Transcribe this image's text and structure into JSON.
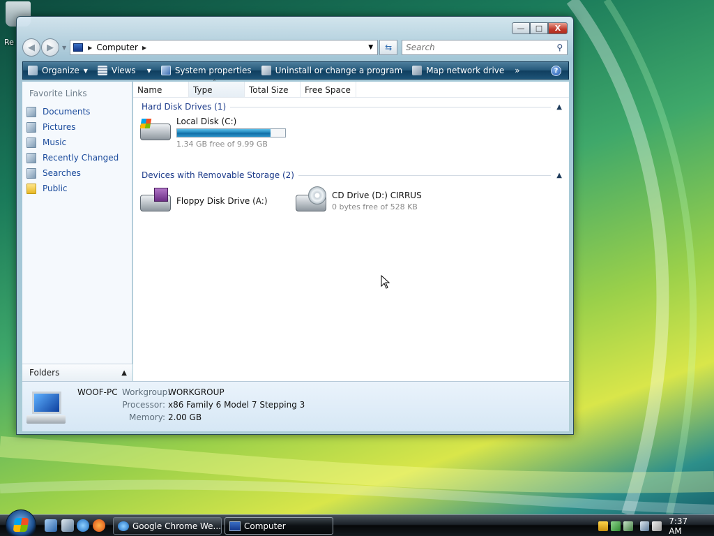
{
  "desktop": {
    "recycle_bin_label": "Re"
  },
  "window": {
    "title_buttons": {
      "minimize": "—",
      "maximize": "□",
      "close": "X"
    },
    "address": {
      "location": "Computer"
    },
    "search": {
      "placeholder": "Search"
    },
    "toolbar": {
      "organize": "Organize",
      "views": "Views",
      "system_properties": "System properties",
      "uninstall": "Uninstall or change a program",
      "map_drive": "Map network drive",
      "more": "»",
      "help": "?"
    },
    "nav_pane": {
      "heading": "Favorite Links",
      "links": [
        {
          "label": "Documents",
          "icon": "documents-icon"
        },
        {
          "label": "Pictures",
          "icon": "pictures-icon"
        },
        {
          "label": "Music",
          "icon": "music-icon"
        },
        {
          "label": "Recently Changed",
          "icon": "recent-icon"
        },
        {
          "label": "Searches",
          "icon": "searches-icon"
        },
        {
          "label": "Public",
          "icon": "folder-icon"
        }
      ],
      "folders_label": "Folders"
    },
    "columns": [
      "Name",
      "Type",
      "Total Size",
      "Free Space"
    ],
    "groups": {
      "hdd": {
        "label": "Hard Disk Drives (1)",
        "drives": [
          {
            "name": "Local Disk (C:)",
            "free_text": "1.34 GB free of 9.99 GB",
            "used_fraction": 0.866
          }
        ]
      },
      "removable": {
        "label": "Devices with Removable Storage (2)",
        "drives": [
          {
            "name": "Floppy Disk Drive (A:)",
            "free_text": ""
          },
          {
            "name": "CD Drive (D:) CIRRUS",
            "free_text": "0 bytes free of 528 KB"
          }
        ]
      }
    },
    "details": {
      "pc_name": "WOOF-PC",
      "workgroup_label": "Workgroup:",
      "workgroup": "WORKGROUP",
      "processor_label": "Processor:",
      "processor": "x86 Family 6 Model 7 Stepping 3",
      "memory_label": "Memory:",
      "memory": "2.00 GB"
    }
  },
  "taskbar": {
    "tasks": [
      {
        "label": "Google Chrome We..."
      },
      {
        "label": "Computer"
      }
    ],
    "clock": "7:37 AM"
  },
  "colors": {
    "toolbar": "#1d5477",
    "link": "#1b4b9c",
    "group_header": "#1b3a8a"
  }
}
